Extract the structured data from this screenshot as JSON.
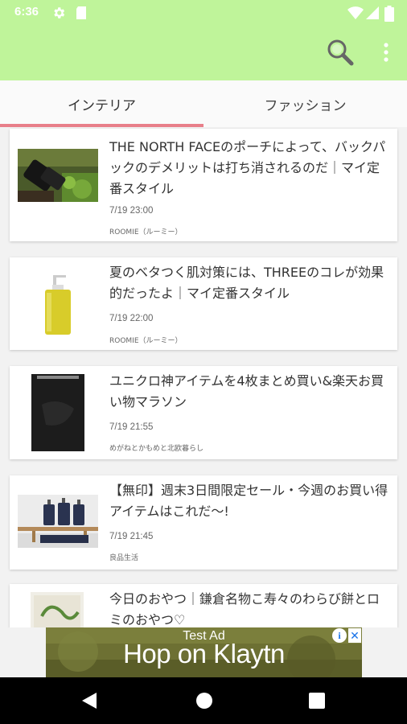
{
  "status_bar": {
    "time": "6:36",
    "icons": [
      "gear-icon",
      "sd-card-icon",
      "wifi-icon",
      "signal-icon",
      "battery-icon"
    ]
  },
  "app_bar": {
    "background": "#bff49a",
    "actions": [
      "search-icon",
      "more-vert-icon"
    ]
  },
  "tabs": [
    {
      "label": "インテリア",
      "selected": true
    },
    {
      "label": "ファッション",
      "selected": false
    }
  ],
  "accent_color": "#e87f8a",
  "articles": [
    {
      "title": "THE NORTH FACEのポーチによって、バックパックのデメリットは打ち消されるのだ｜マイ定番スタイル",
      "time": "7/19 23:00",
      "source": "ROOMIE（ルーミー）",
      "thumb": "black-pouch-on-moss"
    },
    {
      "title": "夏のベタつく肌対策には、THREEのコレが効果的だったよ｜マイ定番スタイル",
      "time": "7/19 22:00",
      "source": "ROOMIE（ルーミー）",
      "thumb": "yellow-pump-bottle"
    },
    {
      "title": "ユニクロ神アイテムを4枚まとめ買い&楽天お買い物マラソン",
      "time": "7/19 21:55",
      "source": "めがねとかもめと北欧暮らし",
      "thumb": "black-clothing-pack"
    },
    {
      "title": "【無印】週末3日間限定セール・今週のお買い得アイテムはこれだ～!",
      "time": "7/19 21:45",
      "source": "良品生活",
      "thumb": "suitcases-on-bench"
    },
    {
      "title": "今日のおやつ｜鎌倉名物こ寿々のわらび餅とロミのおやつ♡",
      "time": "",
      "source": "",
      "thumb": "snack-package"
    }
  ],
  "ad": {
    "label": "Test Ad",
    "text": "Hop on Klaytn",
    "info": "i",
    "close": "✕"
  },
  "nav_bar": {
    "buttons": [
      "back-icon",
      "home-icon",
      "recents-icon"
    ]
  }
}
